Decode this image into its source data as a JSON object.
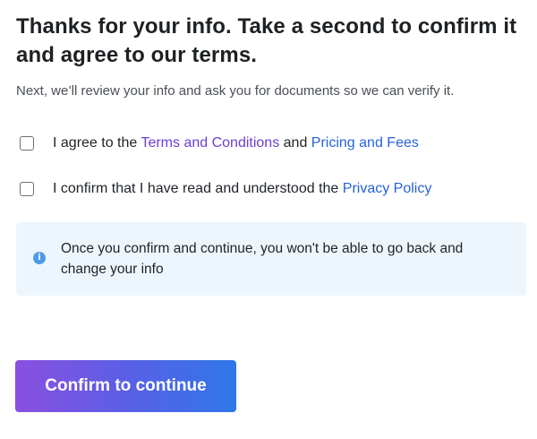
{
  "header": {
    "title": "Thanks for your info. Take a second to confirm it and agree to our terms.",
    "subtitle": "Next, we’ll review your info and ask you for documents so we can verify it."
  },
  "agreements": [
    {
      "prefix": "I agree to the ",
      "link1": "Terms and Conditions",
      "middle": " and ",
      "link2": "Pricing and Fees",
      "checked": false
    },
    {
      "prefix": "I confirm that I have read and understood the ",
      "link1": "Privacy Policy",
      "checked": false
    }
  ],
  "notice": {
    "icon": "info-icon",
    "icon_glyph": "i",
    "text": "Once you confirm and continue, you won't be able to go back and change your info"
  },
  "actions": {
    "confirm_label": "Confirm to continue"
  },
  "colors": {
    "link_purple": "#6a3fd6",
    "link_blue": "#2563d9",
    "notice_bg": "#eef6fd",
    "info_icon": "#4d9ce8",
    "button_gradient_start": "#8b4fe0",
    "button_gradient_end": "#2f77e8"
  }
}
